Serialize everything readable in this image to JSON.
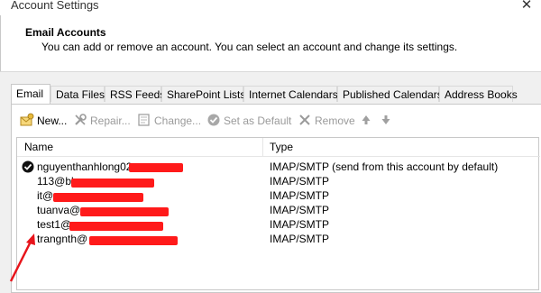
{
  "window": {
    "title": "Account Settings",
    "close_glyph": "✕"
  },
  "header": {
    "title": "Email Accounts",
    "description": "You can add or remove an account. You can select an account and change its settings."
  },
  "tabs": [
    {
      "label": "Email",
      "active": true
    },
    {
      "label": "Data Files",
      "active": false
    },
    {
      "label": "RSS Feeds",
      "active": false
    },
    {
      "label": "SharePoint Lists",
      "active": false
    },
    {
      "label": "Internet Calendars",
      "active": false
    },
    {
      "label": "Published Calendars",
      "active": false
    },
    {
      "label": "Address Books",
      "active": false
    }
  ],
  "toolbar": {
    "new_label": "New...",
    "repair_label": "Repair...",
    "change_label": "Change...",
    "set_default_label": "Set as Default",
    "remove_label": "Remove"
  },
  "list": {
    "columns": {
      "name": "Name",
      "type": "Type"
    },
    "rows": [
      {
        "name": "nguyenthanhlong02",
        "type": "IMAP/SMTP (send from this account by default)",
        "is_default": true
      },
      {
        "name": "113@bl",
        "type": "IMAP/SMTP",
        "is_default": false
      },
      {
        "name": "it@",
        "type": "IMAP/SMTP",
        "is_default": false
      },
      {
        "name": "tuanva@",
        "type": "IMAP/SMTP",
        "is_default": false
      },
      {
        "name": "test1@",
        "type": "IMAP/SMTP",
        "is_default": false
      },
      {
        "name": "trangnth@",
        "type": "IMAP/SMTP",
        "is_default": false
      }
    ]
  },
  "colors": {
    "redaction": "#ff1a1a",
    "annotation_arrow": "#e8141b"
  }
}
